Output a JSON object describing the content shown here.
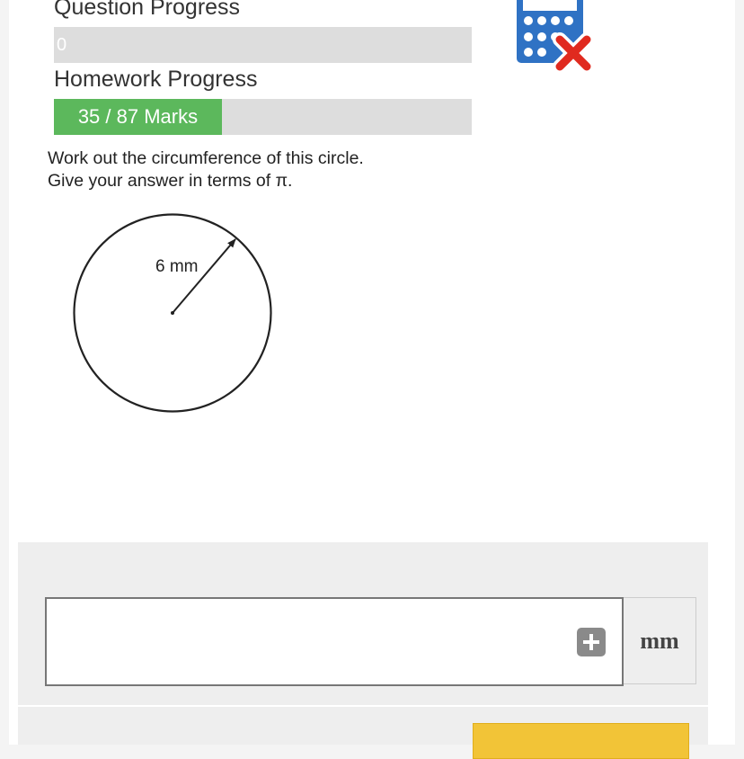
{
  "progress": {
    "question_label": "Question Progress",
    "question_value": "0",
    "question_fraction": 0,
    "homework_label": "Homework Progress",
    "homework_value": "35 / 87 Marks",
    "homework_fraction": 0.402
  },
  "question": {
    "line1": "Work out the circumference of this circle.",
    "line2": "Give your answer in terms of π."
  },
  "diagram": {
    "radius_label": "6 mm"
  },
  "answer": {
    "value": "",
    "unit": "mm"
  },
  "icons": {
    "calculator": "calculator-icon",
    "not_allowed": "cross-icon",
    "insert": "plus-icon"
  },
  "colors": {
    "progress_fill": "#5cb85c",
    "calculator_blue": "#2f72c4",
    "cross_red": "#e02a1f",
    "submit_yellow": "#f2c437"
  }
}
